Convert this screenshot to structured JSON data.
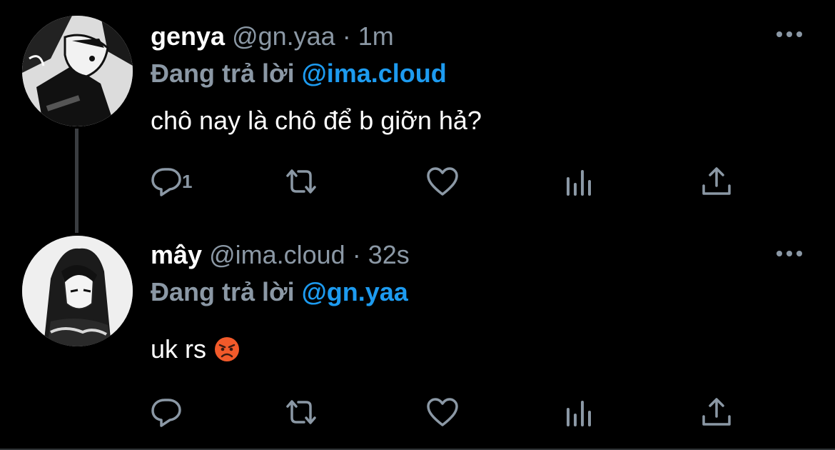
{
  "tweets": [
    {
      "name": "genya",
      "handle": "@gn.yaa",
      "separator": "·",
      "time": "1m",
      "reply_prefix": "Đang trả lời",
      "reply_to": "@ima.cloud",
      "text": "chô nay là chô để b giỡn hả?",
      "reply_count": "1",
      "icons": [
        "reply-icon",
        "retweet-icon",
        "like-icon",
        "analytics-icon",
        "share-icon",
        "more-icon"
      ]
    },
    {
      "name": "mây",
      "handle": "@ima.cloud",
      "separator": "·",
      "time": "32s",
      "reply_prefix": "Đang trả lời",
      "reply_to": "@gn.yaa",
      "text": "uk rs",
      "emoji": "angry-face-emoji",
      "reply_count": "",
      "icons": [
        "reply-icon",
        "retweet-icon",
        "like-icon",
        "analytics-icon",
        "share-icon",
        "more-icon"
      ]
    }
  ],
  "colors": {
    "background": "#000000",
    "secondary_text": "#8b98a5",
    "mention": "#1d9bf0",
    "thread_line": "#3a3d41"
  }
}
